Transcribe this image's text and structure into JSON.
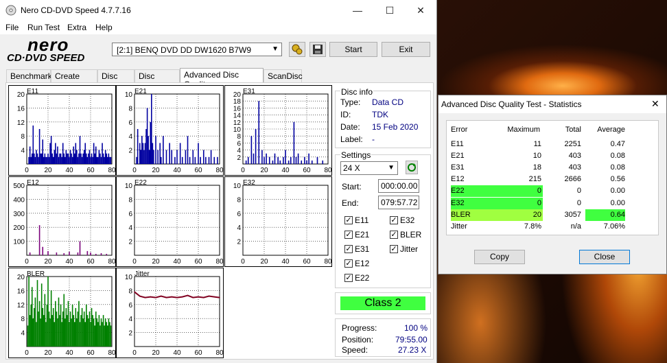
{
  "window": {
    "title": "Nero CD-DVD Speed 4.7.7.16",
    "logo_top": "nero",
    "logo_bottom": "CD·DVD SPEED"
  },
  "menu": [
    "File",
    "Run Test",
    "Extra",
    "Help"
  ],
  "toolbar": {
    "drive": "[2:1]   BENQ DVD DD DW1620 B7W9",
    "start_label": "Start",
    "exit_label": "Exit"
  },
  "tabs": [
    "Benchmark",
    "Create Disc",
    "Disc Info",
    "Disc Quality",
    "Advanced Disc Quality",
    "ScanDisc"
  ],
  "active_tab": 4,
  "disc_info": {
    "header": "Disc info",
    "type_label": "Type:",
    "type_value": "Data CD",
    "id_label": "ID:",
    "id_value": "TDK",
    "date_label": "Date:",
    "date_value": "15 Feb 2020",
    "label_label": "Label:",
    "label_value": "-"
  },
  "settings": {
    "header": "Settings",
    "speed": "24 X",
    "start_label": "Start:",
    "start_value": "000:00.00",
    "end_label": "End:",
    "end_value": "079:57.72",
    "checks": [
      {
        "label": "E11",
        "checked": true
      },
      {
        "label": "E32",
        "checked": true
      },
      {
        "label": "E21",
        "checked": true
      },
      {
        "label": "BLER",
        "checked": true
      },
      {
        "label": "E31",
        "checked": true
      },
      {
        "label": "Jitter",
        "checked": true
      },
      {
        "label": "E12",
        "checked": true
      },
      {
        "label": "E22",
        "checked": true
      }
    ]
  },
  "class_label": "Class 2",
  "progress": {
    "progress_label": "Progress:",
    "progress_value": "100 %",
    "position_label": "Position:",
    "position_value": "79:55.00",
    "speed_label": "Speed:",
    "speed_value": "27.23 X"
  },
  "chart_data": [
    {
      "type": "bar",
      "title": "E11",
      "yticks": [
        4,
        8,
        12,
        16,
        20
      ],
      "xticks": [
        0,
        20,
        40,
        60,
        80
      ],
      "ylim": [
        0,
        20
      ],
      "xlim": [
        0,
        80
      ],
      "color": "#0000a0",
      "x": [
        2,
        3,
        4,
        5,
        6,
        7,
        8,
        9,
        10,
        11,
        12,
        13,
        14,
        15,
        16,
        17,
        18,
        19,
        20,
        21,
        22,
        23,
        24,
        25,
        26,
        27,
        28,
        29,
        30,
        31,
        32,
        33,
        34,
        35,
        36,
        37,
        38,
        39,
        40,
        41,
        42,
        43,
        44,
        45,
        46,
        47,
        48,
        49,
        50,
        51,
        52,
        53,
        54,
        55,
        56,
        57,
        58,
        59,
        60,
        61,
        62,
        63,
        64,
        65,
        66,
        67,
        68,
        69,
        70,
        71,
        72,
        73,
        74,
        75,
        76,
        77,
        78,
        79
      ],
      "values": [
        2,
        5,
        2,
        3,
        11,
        3,
        2,
        4,
        3,
        2,
        10,
        3,
        3,
        7,
        2,
        3,
        2,
        2,
        3,
        2,
        6,
        8,
        3,
        2,
        4,
        6,
        3,
        5,
        2,
        3,
        3,
        2,
        6,
        3,
        2,
        4,
        3,
        3,
        2,
        4,
        3,
        2,
        5,
        3,
        6,
        4,
        2,
        3,
        8,
        3,
        2,
        3,
        4,
        6,
        3,
        2,
        3,
        4,
        2,
        3,
        2,
        6,
        3,
        5,
        2,
        2,
        4,
        3,
        2,
        6,
        3,
        2,
        4,
        3,
        2,
        3,
        2,
        2
      ]
    },
    {
      "type": "bar",
      "title": "E21",
      "yticks": [
        2,
        4,
        6,
        8,
        10
      ],
      "xticks": [
        0,
        20,
        40,
        60,
        80
      ],
      "ylim": [
        0,
        10
      ],
      "xlim": [
        0,
        80
      ],
      "color": "#0000a0",
      "x": [
        2,
        3,
        5,
        6,
        7,
        8,
        9,
        10,
        11,
        12,
        13,
        14,
        15,
        16,
        17,
        18,
        20,
        22,
        24,
        25,
        27,
        30,
        33,
        35,
        38,
        40,
        43,
        45,
        48,
        50,
        52,
        55,
        57,
        60,
        62,
        65,
        67,
        70,
        72,
        75,
        78
      ],
      "values": [
        1,
        5,
        3,
        2,
        4,
        3,
        2,
        3,
        5,
        8,
        4,
        2,
        6,
        10,
        3,
        2,
        4,
        2,
        3,
        1,
        4,
        2,
        3,
        2,
        1,
        2,
        3,
        1,
        2,
        4,
        1,
        2,
        1,
        3,
        1,
        2,
        1,
        1,
        2,
        1,
        1
      ]
    },
    {
      "type": "bar",
      "title": "E31",
      "yticks": [
        2,
        4,
        6,
        8,
        10,
        12,
        14,
        16,
        18,
        20
      ],
      "xticks": [
        0,
        20,
        40,
        60,
        80
      ],
      "ylim": [
        0,
        20
      ],
      "xlim": [
        0,
        80
      ],
      "color": "#0000a0",
      "x": [
        3,
        5,
        8,
        10,
        12,
        15,
        18,
        20,
        22,
        25,
        28,
        30,
        33,
        35,
        38,
        40,
        43,
        45,
        48,
        50,
        52,
        55,
        58,
        60,
        62,
        65,
        70,
        75
      ],
      "values": [
        1,
        2,
        8,
        3,
        10,
        18,
        4,
        2,
        3,
        2,
        1,
        3,
        2,
        1,
        2,
        4,
        1,
        2,
        12,
        2,
        3,
        1,
        2,
        1,
        3,
        1,
        2,
        1
      ]
    },
    {
      "type": "bar",
      "title": "E12",
      "yticks": [
        100,
        200,
        300,
        400,
        500
      ],
      "xticks": [
        0,
        20,
        40,
        60,
        80
      ],
      "ylim": [
        0,
        500
      ],
      "xlim": [
        0,
        80
      ],
      "color": "#7a007a",
      "x": [
        3,
        12,
        15,
        20,
        28,
        35,
        40,
        48,
        50,
        57,
        60,
        65,
        70,
        75
      ],
      "values": [
        20,
        215,
        60,
        30,
        20,
        15,
        25,
        20,
        100,
        30,
        20,
        10,
        15,
        10
      ]
    },
    {
      "type": "bar",
      "title": "E22",
      "yticks": [
        2,
        4,
        6,
        8,
        10
      ],
      "xticks": [
        0,
        20,
        40,
        60,
        80
      ],
      "ylim": [
        0,
        10
      ],
      "xlim": [
        0,
        80
      ],
      "color": "#0000a0",
      "x": [],
      "values": []
    },
    {
      "type": "bar",
      "title": "E32",
      "yticks": [
        2,
        4,
        6,
        8,
        10
      ],
      "xticks": [
        0,
        20,
        40,
        60,
        80
      ],
      "ylim": [
        0,
        10
      ],
      "xlim": [
        0,
        80
      ],
      "color": "#0000a0",
      "x": [],
      "values": []
    },
    {
      "type": "bar",
      "title": "BLER",
      "yticks": [
        4,
        8,
        12,
        16,
        20
      ],
      "xticks": [
        0,
        20,
        40,
        60,
        80
      ],
      "ylim": [
        0,
        20
      ],
      "xlim": [
        0,
        80
      ],
      "color": "#008000",
      "x": [
        1,
        2,
        3,
        4,
        5,
        6,
        7,
        8,
        9,
        10,
        11,
        12,
        13,
        14,
        15,
        16,
        17,
        18,
        19,
        20,
        21,
        22,
        23,
        24,
        25,
        26,
        27,
        28,
        29,
        30,
        31,
        32,
        33,
        34,
        35,
        36,
        37,
        38,
        39,
        40,
        41,
        42,
        43,
        44,
        45,
        46,
        47,
        48,
        49,
        50,
        51,
        52,
        53,
        54,
        55,
        56,
        57,
        58,
        59,
        60,
        61,
        62,
        63,
        64,
        65,
        66,
        67,
        68,
        69,
        70,
        71,
        72,
        73,
        74,
        75,
        76,
        77,
        78,
        79
      ],
      "values": [
        6,
        20,
        9,
        12,
        17,
        8,
        11,
        14,
        7,
        19,
        10,
        13,
        8,
        18,
        11,
        9,
        15,
        7,
        12,
        20,
        10,
        8,
        16,
        9,
        11,
        7,
        13,
        10,
        8,
        14,
        9,
        12,
        7,
        10,
        15,
        8,
        11,
        9,
        13,
        7,
        10,
        8,
        12,
        9,
        7,
        11,
        8,
        10,
        13,
        7,
        9,
        11,
        8,
        10,
        7,
        12,
        9,
        8,
        10,
        7,
        11,
        9,
        8,
        6,
        10,
        8,
        7,
        9,
        6,
        8,
        7,
        9,
        6,
        8,
        7,
        6,
        8,
        7,
        6
      ]
    },
    {
      "type": "line",
      "title": "Jitter",
      "yticks": [
        2,
        4,
        6,
        8,
        10
      ],
      "xticks": [
        0,
        20,
        40,
        60,
        80
      ],
      "ylim": [
        0,
        10
      ],
      "xlim": [
        0,
        80
      ],
      "color": "#800020",
      "x": [
        0,
        5,
        10,
        15,
        20,
        25,
        30,
        35,
        40,
        45,
        50,
        55,
        60,
        65,
        70,
        75,
        80
      ],
      "values": [
        7.8,
        7.2,
        7.0,
        7.1,
        7.0,
        7.2,
        7.0,
        7.1,
        7.0,
        7.1,
        7.3,
        7.0,
        7.1,
        7.0,
        7.2,
        7.1,
        7.0
      ]
    }
  ],
  "stats": {
    "title": "Advanced Disc Quality Test - Statistics",
    "headers": [
      "Error",
      "Maximum",
      "Total",
      "Average"
    ],
    "rows": [
      {
        "name": "E11",
        "max": "11",
        "total": "2251",
        "avg": "0.47",
        "hl_name": false,
        "hl_avg": false
      },
      {
        "name": "E21",
        "max": "10",
        "total": "403",
        "avg": "0.08",
        "hl_name": false,
        "hl_avg": false
      },
      {
        "name": "E31",
        "max": "18",
        "total": "403",
        "avg": "0.08",
        "hl_name": false,
        "hl_avg": false
      },
      {
        "name": "E12",
        "max": "215",
        "total": "2666",
        "avg": "0.56",
        "hl_name": false,
        "hl_avg": false
      },
      {
        "name": "E22",
        "max": "0",
        "total": "0",
        "avg": "0.00",
        "hl_name": true,
        "hl_avg": false
      },
      {
        "name": "E32",
        "max": "0",
        "total": "0",
        "avg": "0.00",
        "hl_name": true,
        "hl_avg": false
      },
      {
        "name": "BLER",
        "max": "20",
        "total": "3057",
        "avg": "0.64",
        "hl_name": true,
        "hl_avg": true
      },
      {
        "name": "Jitter",
        "max": "7.8%",
        "total": "n/a",
        "avg": "7.06%",
        "hl_name": false,
        "hl_avg": false
      }
    ],
    "copy_label": "Copy",
    "close_label": "Close"
  },
  "colors": {
    "highlight_green": "#40ff40",
    "bler_green": "#a0ff40",
    "class_green": "#40ff40"
  }
}
